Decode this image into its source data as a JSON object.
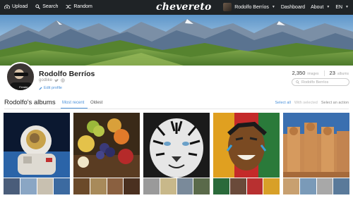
{
  "topbar": {
    "upload_label": "Upload",
    "search_label": "Search",
    "random_label": "Random",
    "logo": "chevereto",
    "user_name": "Rodolfo Berríos",
    "dashboard_label": "Dashboard",
    "about_label": "About",
    "lang_label": "EN"
  },
  "profile": {
    "name": "Rodolfo Berríos",
    "handle": "godlike",
    "edit_label": "Edit profile",
    "avatar_logo": "Fender",
    "images_count": "2,350",
    "images_label": "images",
    "albums_count": "23",
    "albums_label": "albums",
    "search_placeholder": "Rodolfo Berríos"
  },
  "albums_section": {
    "title": "Rodolfo's albums",
    "tab_recent": "Most recent",
    "tab_oldest": "Oldest",
    "select_all": "Select all",
    "with_selected": "With selected",
    "select_action": "Select an action"
  },
  "colors": {
    "accent": "#4a90d9",
    "topbar_bg": "#1f2326"
  }
}
